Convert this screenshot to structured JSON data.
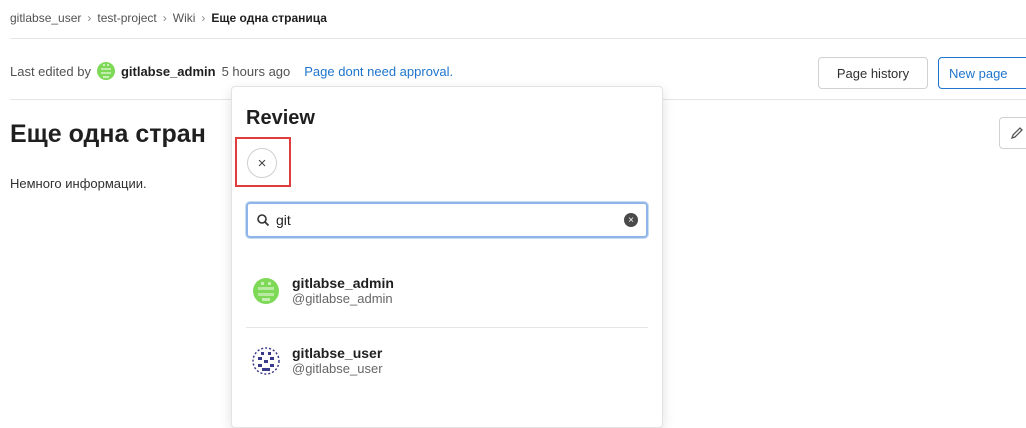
{
  "breadcrumb": {
    "items": [
      "gitlabse_user",
      "test-project",
      "Wiki"
    ],
    "current": "Еще одна страница",
    "separator": "›"
  },
  "meta": {
    "prefix": "Last edited by",
    "author": "gitlabse_admin",
    "time": "5 hours ago",
    "approval": "Page dont need approval."
  },
  "buttons": {
    "history": "Page history",
    "new_page": "New page"
  },
  "page": {
    "title": "Еще одна стран",
    "body": "Немного информации."
  },
  "review": {
    "title": "Review",
    "close": "×",
    "search_value": "git",
    "clear": "×",
    "users": [
      {
        "name": "gitlabse_admin",
        "handle": "@gitlabse_admin",
        "color": "#7ed957"
      },
      {
        "name": "gitlabse_user",
        "handle": "@gitlabse_user",
        "color": "#3a3a8a"
      }
    ]
  },
  "colors": {
    "link": "#1f75cb",
    "highlight": "#e03c3c"
  }
}
